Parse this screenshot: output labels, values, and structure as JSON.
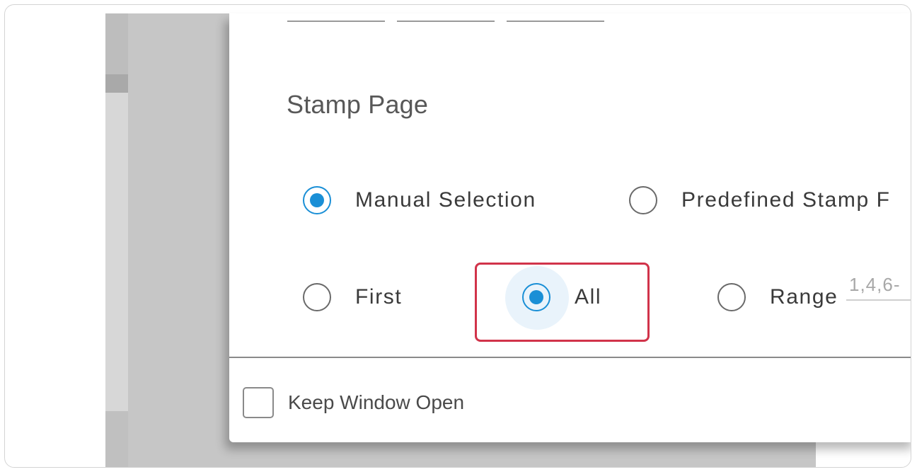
{
  "stamp_page": {
    "title": "Stamp Page",
    "mode_options": [
      {
        "label": "Manual Selection",
        "checked": true
      },
      {
        "label": "Predefined Stamp F",
        "checked": false
      }
    ],
    "page_options": [
      {
        "label": "First",
        "checked": false
      },
      {
        "label": "All",
        "checked": true
      },
      {
        "label": "Range",
        "checked": false
      }
    ],
    "range_placeholder": "1,4,6-"
  },
  "footer": {
    "keep_window_open_label": "Keep Window Open",
    "keep_window_open_checked": false
  },
  "colors": {
    "accent": "#1a8fd6",
    "highlight": "#d1334a"
  }
}
